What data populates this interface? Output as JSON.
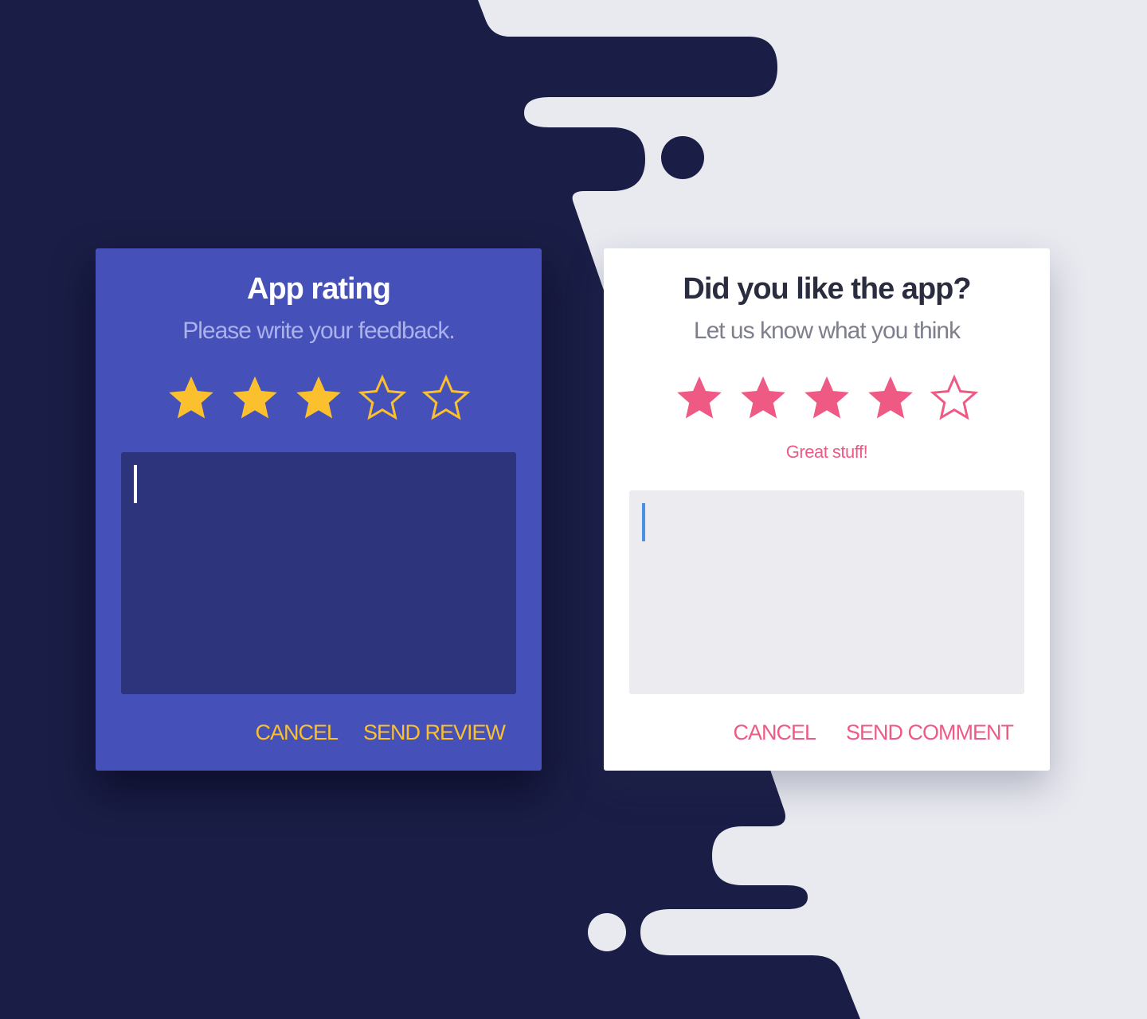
{
  "colors": {
    "navy_background": "#1a1d45",
    "light_background": "#e9eaf0",
    "dark_card": "#4551b9",
    "dark_textarea": "#2e347c",
    "gold_accent": "#fbc02d",
    "pink_accent": "#ef5a85",
    "light_textarea": "#ebebf0",
    "caret_blue": "#4a90e2"
  },
  "dark_dialog": {
    "title": "App rating",
    "subtitle": "Please write your feedback.",
    "rating": {
      "value": 3,
      "max": 5,
      "icon": "star-icon"
    },
    "comment_value": "",
    "cancel_label": "CANCEL",
    "submit_label": "SEND REVIEW"
  },
  "light_dialog": {
    "title": "Did you like the app?",
    "subtitle": "Let us know what you think",
    "rating": {
      "value": 4,
      "max": 5,
      "icon": "star-icon"
    },
    "rating_caption": "Great stuff!",
    "comment_value": "",
    "cancel_label": "CANCEL",
    "submit_label": "SEND COMMENT"
  }
}
